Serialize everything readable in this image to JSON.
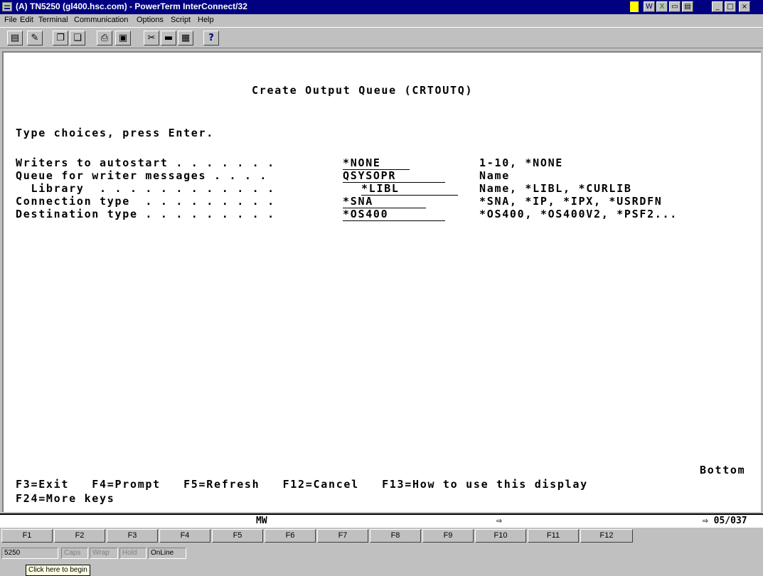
{
  "window": {
    "title": "(A) TN5250 (gl400.hsc.com) - PowerTerm InterConnect/32",
    "minimize_glyph": "_",
    "maximize_glyph": "□",
    "close_glyph": "×"
  },
  "menu": [
    "File",
    "Edit",
    "Terminal",
    "Communication",
    "Options",
    "Script",
    "Help"
  ],
  "toolbar_icons": [
    "printer-icon",
    "edit-icon",
    "copy-icon",
    "paste-icon",
    "print-screen-icon",
    "monitor-icon",
    "settings-icon",
    "keyboard-icon",
    "grid-icon",
    "help-icon"
  ],
  "toolbar_glyphs": [
    "▤",
    "✎",
    "❐",
    "❏",
    "⎙",
    "▣",
    "✂",
    "▬",
    "▦",
    "?"
  ],
  "screen": {
    "heading": "Create Output Queue (CRTOUTQ)",
    "instruction": "Type choices, press Enter.",
    "rows": [
      {
        "label": "Writers to autostart . . . . . . .",
        "value": "*NONE",
        "help": "1-10, *NONE"
      },
      {
        "label": "Queue for writer messages . . . .",
        "value": "QSYSOPR",
        "help": "Name"
      },
      {
        "label": "  Library  . . . . . . . . . . . .",
        "value": "*LIBL",
        "help": "Name, *LIBL, *CURLIB"
      },
      {
        "label": "Connection type  . . . . . . . . .",
        "value": "*SNA",
        "help": "*SNA, *IP, *IPX, *USRDFN"
      },
      {
        "label": "Destination type . . . . . . . . .",
        "value": "*OS400",
        "help": "*OS400, *OS400V2, *PSF2..."
      }
    ],
    "bottom_label": "Bottom",
    "fkeys_line1": "F3=Exit   F4=Prompt   F5=Refresh   F12=Cancel   F13=How to use this display",
    "fkeys_line2": "F24=More keys"
  },
  "status_line": {
    "mw": "MW",
    "arrow": "⇨",
    "cursor": "⇨ 05/037"
  },
  "fkey_buttons": [
    "F1",
    "F2",
    "F3",
    "F4",
    "F5",
    "F6",
    "F7",
    "F8",
    "F9",
    "F10",
    "F11",
    "F12"
  ],
  "bottom_status": {
    "session": "5250",
    "caps": "Caps",
    "wrap": "Wrap",
    "hold": "Hold",
    "online": "OnLine",
    "tooltip": "Click here to begin"
  }
}
